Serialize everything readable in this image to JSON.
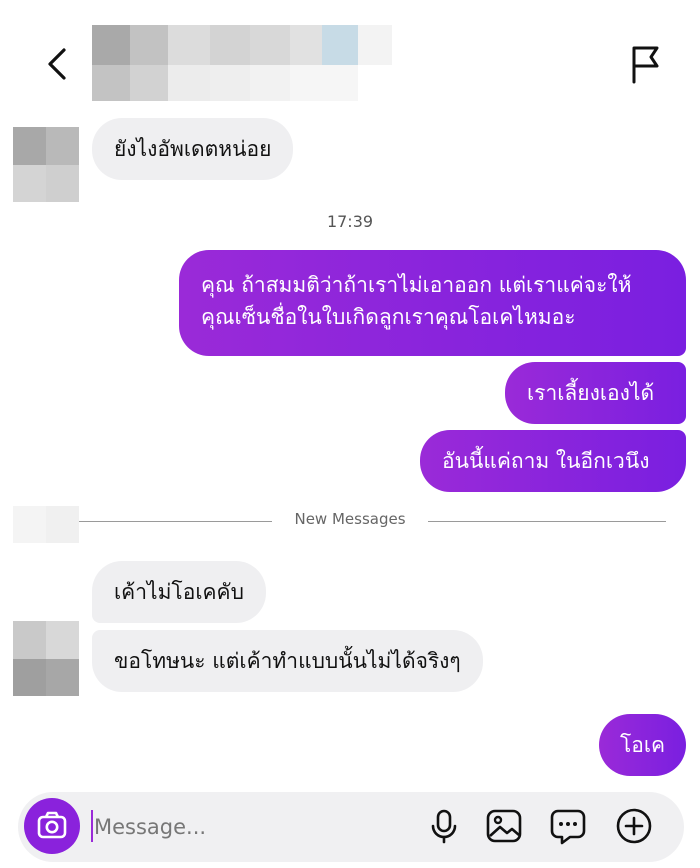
{
  "header": {
    "back_icon": "chevron-left-icon",
    "report_icon": "flag-icon"
  },
  "messages": [
    {
      "side": "received",
      "text": "ยังไงอัพเดตหน่อย"
    },
    {
      "side": "sent",
      "lines": [
        "คุณ ถ้าสมมติว่าถ้าเราไม่เอาออก แต่เราแค่จะให้",
        "คุณเซ็นชื่อในใบเกิดลูกเราคุณโอเคไหมอะ"
      ]
    },
    {
      "side": "sent",
      "text": "เราเลี้ยงเองได้"
    },
    {
      "side": "sent",
      "text": "อันนี้แค่ถาม ในอีกเวนึง"
    },
    {
      "side": "received",
      "text": "เค้าไม่โอเคคับ"
    },
    {
      "side": "received",
      "text": "ขอโทษนะ แต่เค้าทำแบบนั้นไม่ได้จริงๆ"
    },
    {
      "side": "sent",
      "text": "โอเค"
    }
  ],
  "timestamp": "17:39",
  "divider": {
    "label": "New Messages"
  },
  "composer": {
    "placeholder": "Message...",
    "icons": [
      "camera-icon",
      "microphone-icon",
      "image-icon",
      "sticker-icon",
      "add-circle-icon"
    ]
  },
  "colors": {
    "accent": "#8a22dc",
    "sent_bubble_start": "#9a2ad8",
    "sent_bubble_end": "#7a1fe0",
    "received_bubble": "#efeff1",
    "composer_bg": "#f0f0f2"
  }
}
